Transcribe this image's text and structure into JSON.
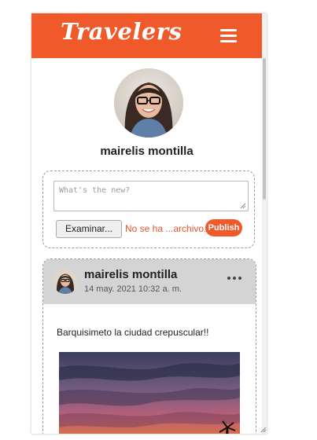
{
  "app": {
    "brand": "Travelers",
    "colors": {
      "accent": "#f05a2a",
      "header_bg": "#f05a2a",
      "post_header_bg": "#d4d4d4"
    },
    "menu_icon": "hamburger-menu-icon"
  },
  "profile": {
    "name": "mairelis montilla",
    "avatar_icon": "user-avatar"
  },
  "composer": {
    "placeholder": "What's the new?",
    "browse_label": "Examinar...",
    "file_status": "No se ha ...archivo.",
    "publish_label": "Publish"
  },
  "posts": [
    {
      "author": "mairelis montilla",
      "date": "14 may. 2021 10:32 a. m.",
      "text": "Barquisimeto la ciudad crepuscular!!",
      "more_icon": "more-options-icon",
      "photo": "sunset-photo"
    }
  ]
}
